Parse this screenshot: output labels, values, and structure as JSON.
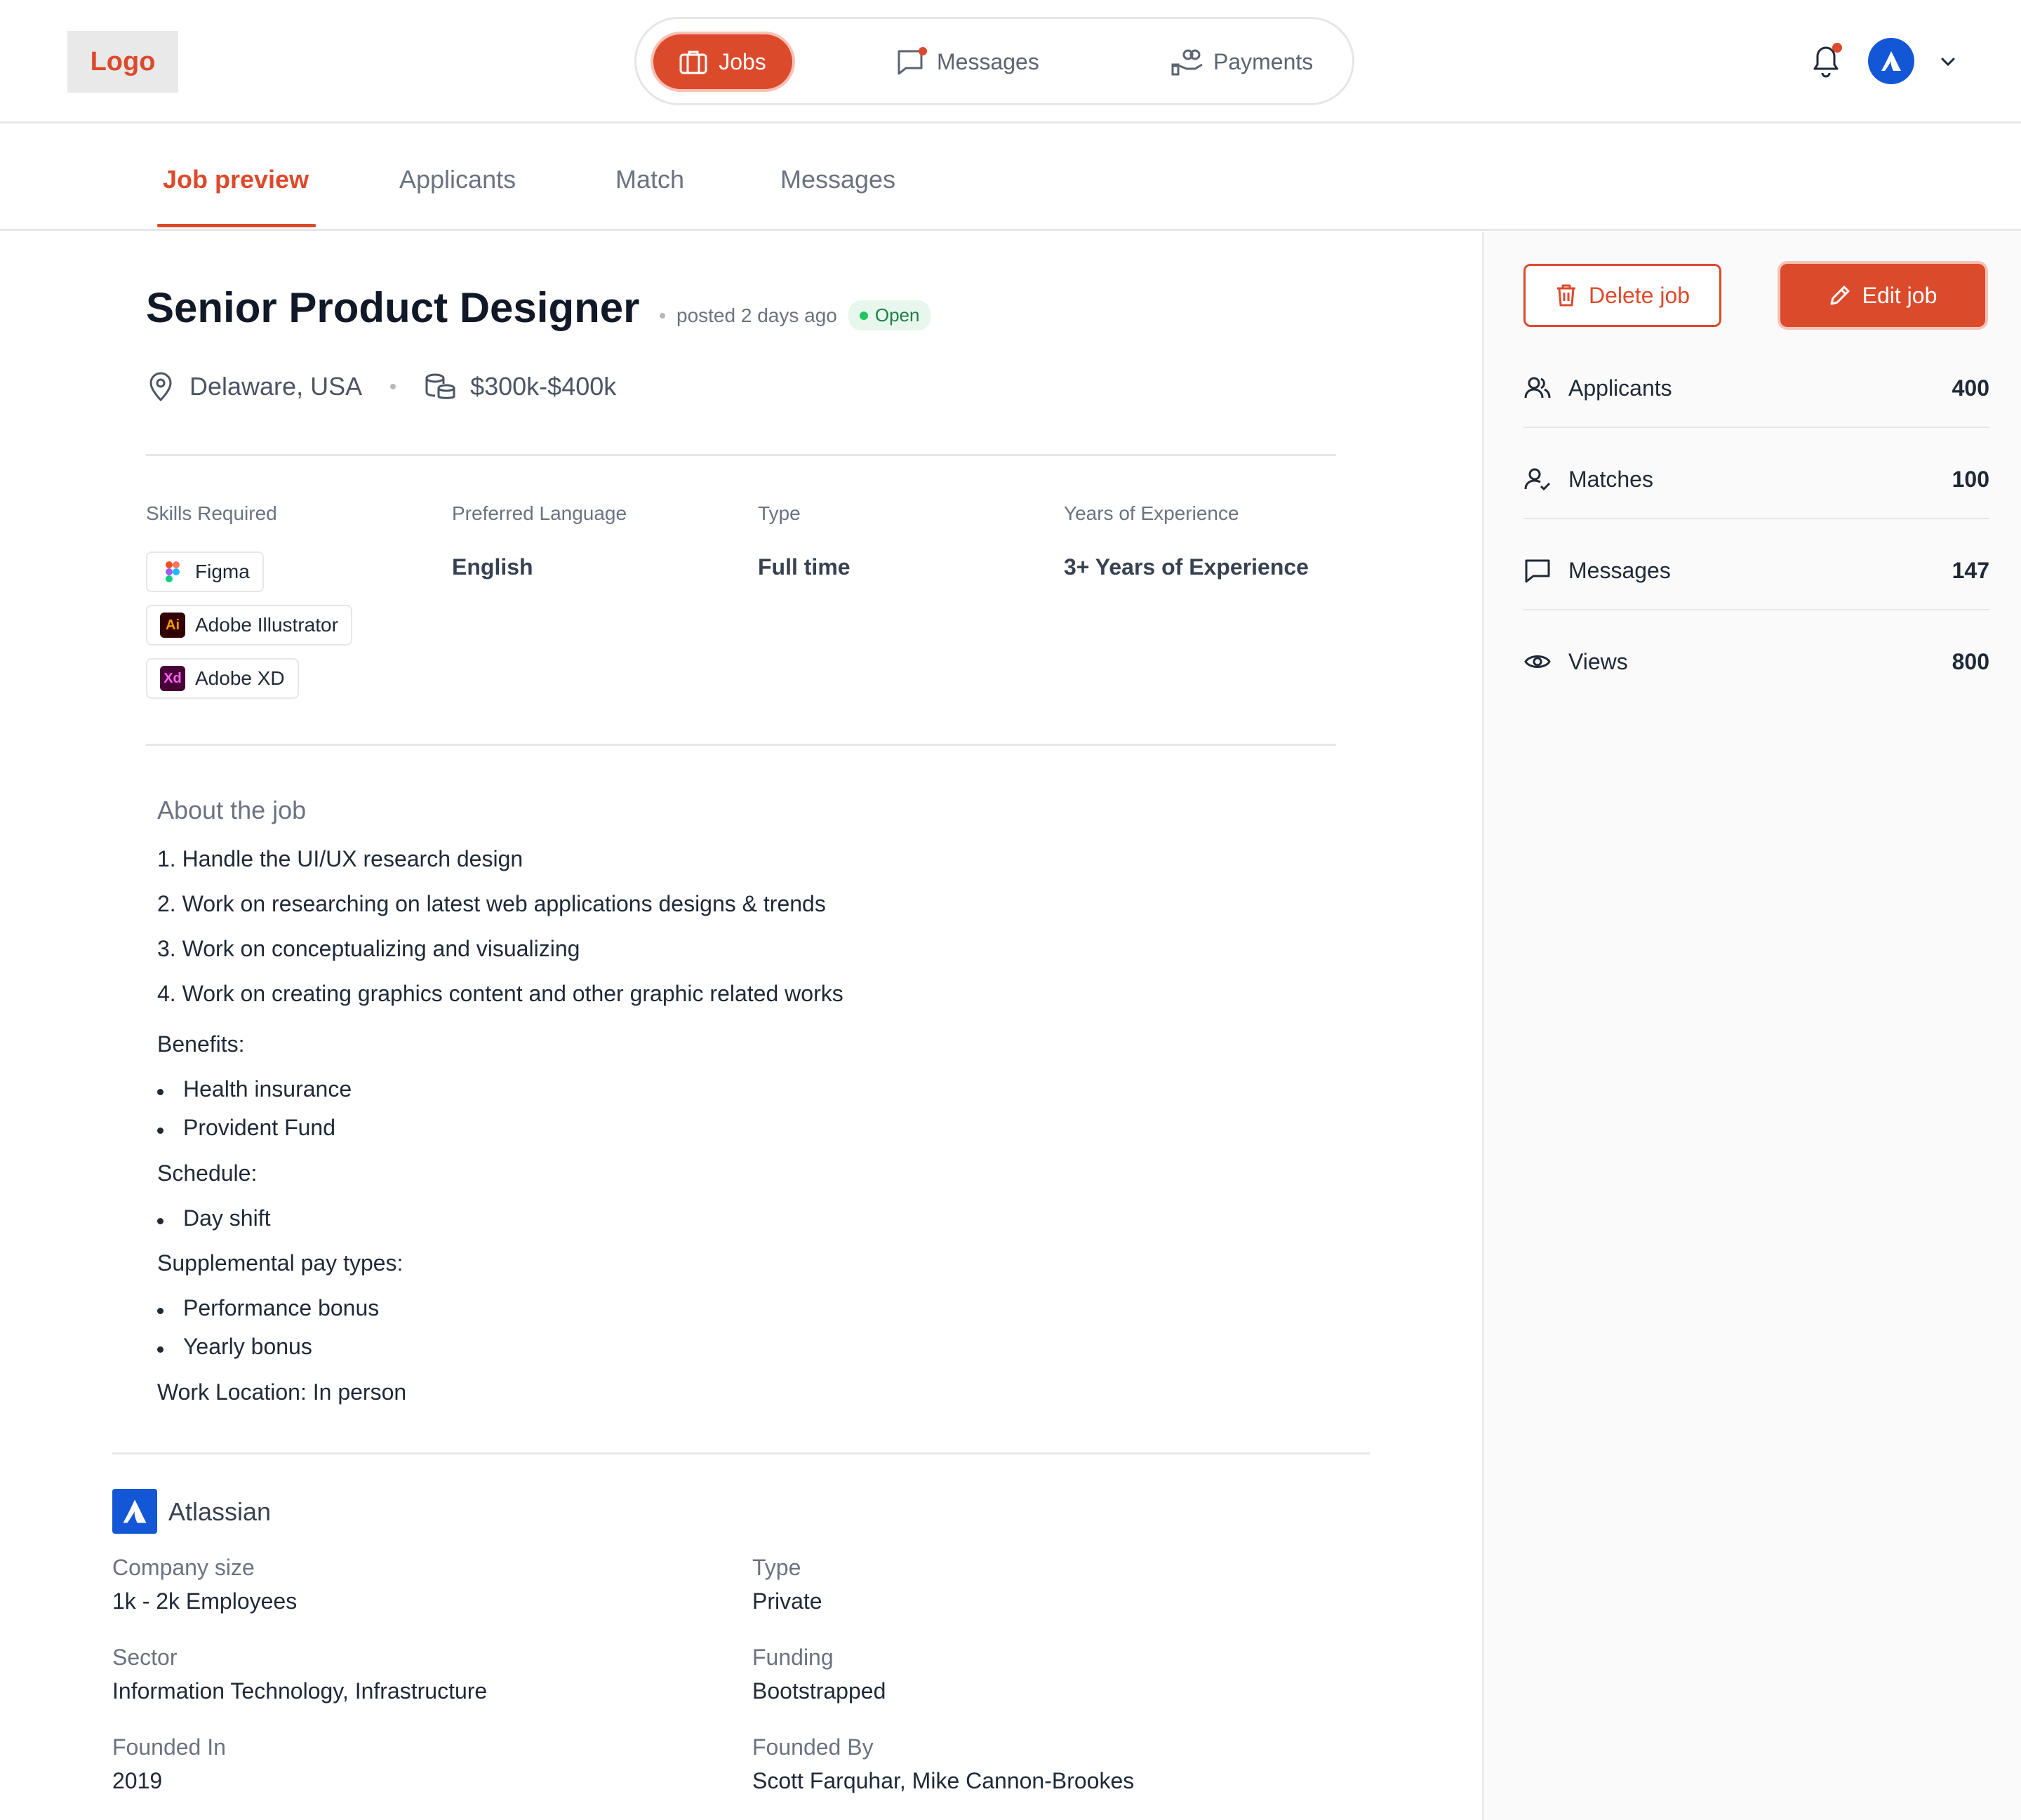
{
  "header": {
    "logo": "Logo",
    "nav": {
      "jobs": "Jobs",
      "messages": "Messages",
      "payments": "Payments"
    }
  },
  "tabs": [
    "Job preview",
    "Applicants",
    "Match",
    "Messages"
  ],
  "job": {
    "title": "Senior Product Designer",
    "posted": "posted 2 days ago",
    "status": "Open",
    "location": "Delaware, USA",
    "salary": "$300k-$400k"
  },
  "details": {
    "skills_label": "Skills Required",
    "skills": [
      {
        "name": "Figma",
        "icon": "figma-icon"
      },
      {
        "name": "Adobe Illustrator",
        "icon": "Ai"
      },
      {
        "name": "Adobe XD",
        "icon": "Xd"
      }
    ],
    "language_label": "Preferred Language",
    "language": "English",
    "type_label": "Type",
    "type": "Full time",
    "experience_label": "Years of Experience",
    "experience": "3+ Years of Experience"
  },
  "about": {
    "heading": "About the job",
    "items": [
      "1. Handle the UI/UX research design",
      "2. Work on researching on latest web applications designs & trends",
      "3. Work on conceptualizing and visualizing",
      "4. Work on creating graphics content and other graphic related works"
    ],
    "benefits_label": "Benefits:",
    "benefits": [
      "Health insurance",
      "Provident Fund"
    ],
    "schedule_label": "Schedule:",
    "schedule": [
      "Day shift"
    ],
    "pay_label": "Supplemental pay types:",
    "pay": [
      "Performance bonus",
      "Yearly bonus"
    ],
    "work_location": "Work Location: In person"
  },
  "company": {
    "name": "Atlassian",
    "size_label": "Company size",
    "size": "1k - 2k Employees",
    "type_label": "Type",
    "type": "Private",
    "sector_label": "Sector",
    "sector": "Information Technology, Infrastructure",
    "funding_label": "Funding",
    "funding": "Bootstrapped",
    "founded_label": "Founded In",
    "founded": "2019",
    "founders_label": "Founded By",
    "founders": "Scott Farquhar, Mike Cannon-Brookes"
  },
  "sidebar": {
    "delete": "Delete job",
    "edit": "Edit job",
    "stats": [
      {
        "label": "Applicants",
        "value": "400",
        "icon": "users-icon"
      },
      {
        "label": "Matches",
        "value": "100",
        "icon": "user-check-icon"
      },
      {
        "label": "Messages",
        "value": "147",
        "icon": "chat-icon"
      },
      {
        "label": "Views",
        "value": "800",
        "icon": "eye-icon"
      }
    ]
  },
  "colors": {
    "accent": "#dc4a2c",
    "brand_blue": "#1457d6",
    "open_green": "#22c55e"
  }
}
